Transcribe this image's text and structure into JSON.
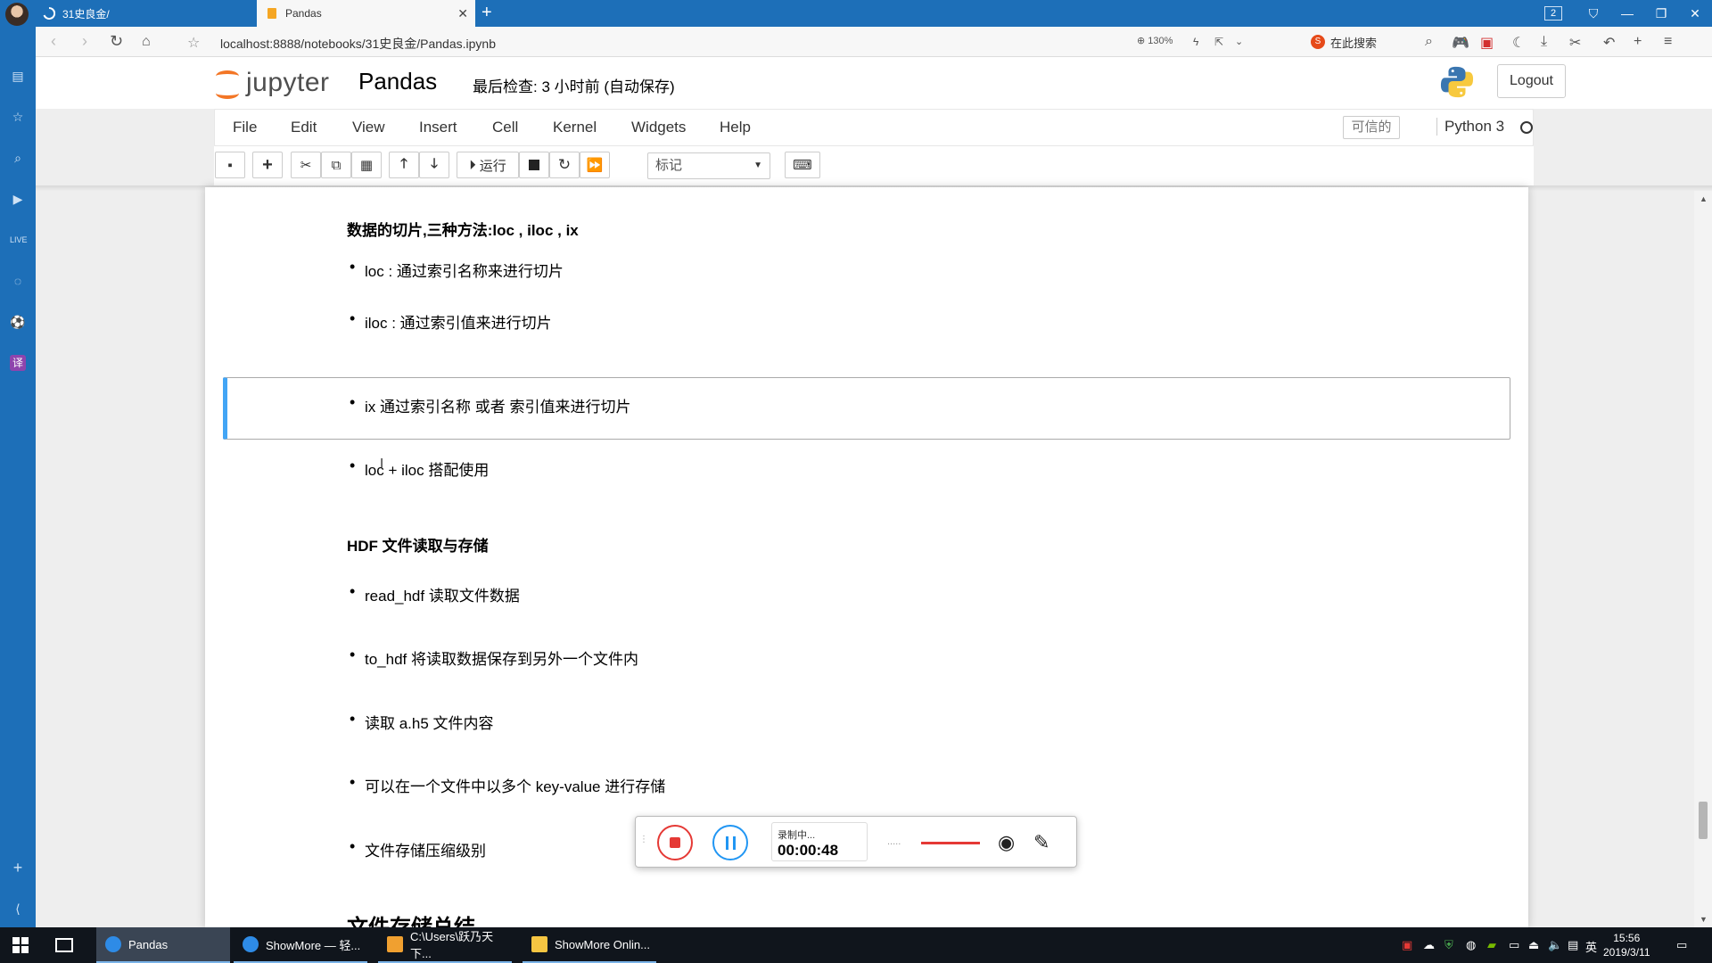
{
  "browser": {
    "tabs": [
      {
        "label": "31史良金/"
      },
      {
        "label": "Pandas"
      }
    ],
    "window_badge": "2",
    "url": "localhost:8888/notebooks/31史良金/Pandas.ipynb",
    "zoom": "130%",
    "search_placeholder": "在此搜索"
  },
  "jupyter": {
    "logo_text": "jupyter",
    "notebook_name": "Pandas",
    "checkpoint": "最后检查: 3 小时前   (自动保存)",
    "logout_label": "Logout",
    "menu": [
      "File",
      "Edit",
      "View",
      "Insert",
      "Cell",
      "Kernel",
      "Widgets",
      "Help"
    ],
    "trusted_label": "可信的",
    "kernel_name": "Python 3",
    "toolbar": {
      "run_label": "运行",
      "cell_type": "标记"
    }
  },
  "notebook": {
    "section1_title": "数据的切片,三种方法:loc , iloc , ix",
    "section1_items": [
      "loc : 通过索引名称来进行切片",
      "iloc : 通过索引值来进行切片",
      "ix 通过索引名称 或者 索引值来进行切片",
      "loc + iloc 搭配使用"
    ],
    "section2_title": "HDF 文件读取与存储",
    "section2_items": [
      "read_hdf 读取文件数据",
      "to_hdf 将读取数据保存到另外一个文件内",
      "读取 a.h5 文件内容",
      "可以在一个文件中以多个 key-value 进行存储",
      "文件存储压缩级别"
    ],
    "section3_title": "文件存储总结"
  },
  "recorder": {
    "status": "录制中...",
    "time": "00:00:48"
  },
  "taskbar": {
    "tasks": [
      {
        "label": "Pandas"
      },
      {
        "label": "ShowMore — 轻..."
      },
      {
        "label": "C:\\Users\\跃乃天下..."
      },
      {
        "label": "ShowMore Onlin..."
      }
    ],
    "ime": "英",
    "time": "15:56",
    "date": "2019/3/11"
  },
  "colors": {
    "browser_blue": "#1d6fb8",
    "jupyter_orange": "#f37626",
    "selected_cell": "#42a5f5",
    "record_red": "#e53935"
  }
}
